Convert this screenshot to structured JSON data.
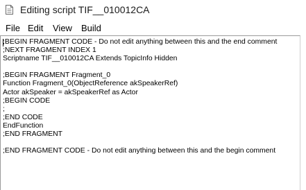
{
  "window": {
    "title": "Editing script TIF__010012CA"
  },
  "menu": [
    {
      "label": "File"
    },
    {
      "label": "Edit"
    },
    {
      "label": "View"
    },
    {
      "label": "Build"
    }
  ],
  "editor": {
    "lines": [
      ";BEGIN FRAGMENT CODE - Do not edit anything between this and the end comment",
      ";NEXT FRAGMENT INDEX 1",
      "Scriptname TIF__010012CA Extends TopicInfo Hidden",
      "",
      ";BEGIN FRAGMENT Fragment_0",
      "Function Fragment_0(ObjectReference akSpeakerRef)",
      "Actor akSpeaker = akSpeakerRef as Actor",
      ";BEGIN CODE",
      ";",
      ";END CODE",
      "EndFunction",
      ";END FRAGMENT",
      "",
      ";END FRAGMENT CODE - Do not edit anything between this and the begin comment"
    ]
  },
  "icons": {
    "app": "notepad-document-icon"
  }
}
